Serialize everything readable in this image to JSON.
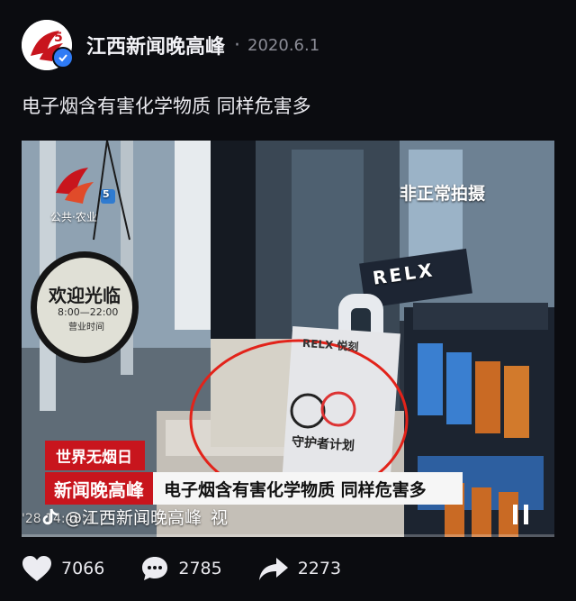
{
  "post": {
    "author": "江西新闻晚高峰",
    "separator": "·",
    "date": "2020.6.1",
    "text": "电子烟含有害化学物质 同样危害多"
  },
  "video": {
    "station_logo_text": "公共·农业",
    "hidden_filming_label": "非正常拍摄",
    "sign_line1": "欢迎光临",
    "sign_line2": "8:00—22:00",
    "sign_line3": "营业时间",
    "brand_text": "RELX",
    "brand_sub": "RELX 悦刻",
    "card_text": "守护者计划",
    "lower_third_top": "世界无烟日",
    "lower_third_show": "新闻晚高峰",
    "lower_third_headline": "电子烟含有害化学物质 同样危害多",
    "timestamp": "'28 14:48:4",
    "watermark_account": "@江西新闻晚高峰",
    "watermark_trail": "视",
    "progress": 0.0
  },
  "actions": {
    "likes": "7066",
    "comments": "2785",
    "shares": "2273"
  },
  "colors": {
    "background": "#0b0c10",
    "news_red": "#c8151d",
    "verified_blue": "#2f7bf5"
  }
}
